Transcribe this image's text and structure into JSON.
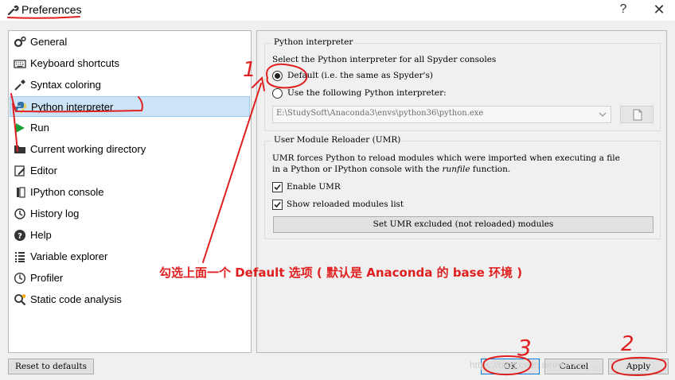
{
  "window": {
    "title": "Preferences",
    "help_label": "?",
    "close_label": "✕"
  },
  "sidebar": {
    "items": [
      {
        "label": "General",
        "icon": "gear-icon"
      },
      {
        "label": "Keyboard shortcuts",
        "icon": "keyboard-icon"
      },
      {
        "label": "Syntax coloring",
        "icon": "dropper-icon"
      },
      {
        "label": "Python interpreter",
        "icon": "python-icon"
      },
      {
        "label": "Run",
        "icon": "run-icon"
      },
      {
        "label": "Current working directory",
        "icon": "folder-icon"
      },
      {
        "label": "Editor",
        "icon": "edit-icon"
      },
      {
        "label": "IPython console",
        "icon": "console-icon"
      },
      {
        "label": "History log",
        "icon": "history-icon"
      },
      {
        "label": "Help",
        "icon": "help-icon"
      },
      {
        "label": "Variable explorer",
        "icon": "list-icon"
      },
      {
        "label": "Profiler",
        "icon": "profiler-icon"
      },
      {
        "label": "Static code analysis",
        "icon": "analysis-icon"
      }
    ],
    "selected": "Python interpreter"
  },
  "interpreter": {
    "group_title": "Python interpreter",
    "description": "Select the Python interpreter for all Spyder consoles",
    "option_default": "Default (i.e. the same as Spyder's)",
    "option_custom": "Use the following Python interpreter:",
    "path_value": "E:\\StudySoft\\Anaconda3\\envs\\python36\\python.exe"
  },
  "umr": {
    "group_title": "User Module Reloader (UMR)",
    "description_line1": "UMR forces Python to reload modules which were imported when executing a file",
    "description_line2_prefix": "in a Python or IPython console with the ",
    "description_line2_em": "runfile",
    "description_line2_suffix": " function.",
    "enable_label": "Enable UMR",
    "show_list_label": "Show reloaded modules list",
    "excluded_button": "Set UMR excluded (not reloaded) modules"
  },
  "footer": {
    "reset_label": "Reset to defaults",
    "ok_label": "OK",
    "cancel_label": "Cancel",
    "apply_label": "Apply"
  },
  "annotations": {
    "main_note": "勾选上面一个 Default 选项 ( 默认是 Anaconda 的 base 环境 )",
    "mark_1": "1",
    "mark_2": "2",
    "mark_3": "3",
    "watermark": "https://blog.csdn.net/weixin_..."
  },
  "colors": {
    "accent": "#0078d7",
    "selection": "#cce4f7",
    "annotation": "#e02020"
  }
}
